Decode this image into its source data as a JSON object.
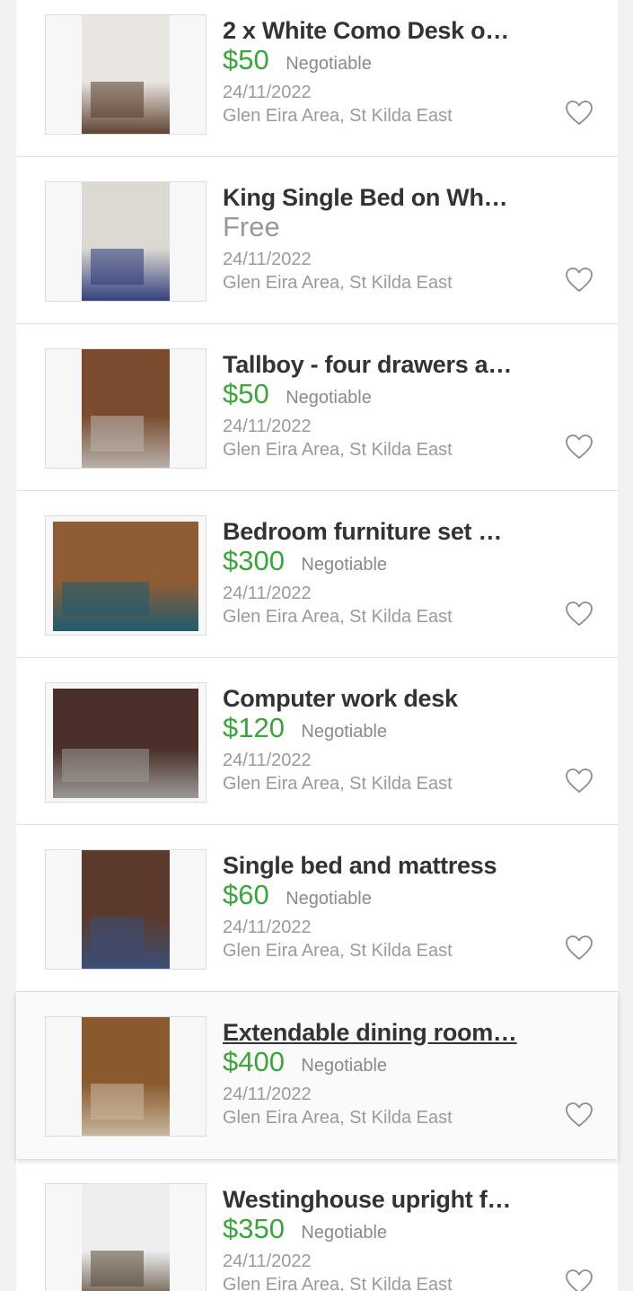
{
  "listings": [
    {
      "title": "2 x White Como Desk o…",
      "price": "$50",
      "negotiable": "Negotiable",
      "date": "24/11/2022",
      "location": "Glen Eira Area, St Kilda East",
      "photo_colors": [
        "#e9e6e1",
        "#5a3d2c"
      ]
    },
    {
      "title": "King Single Bed on Wh…",
      "price": "Free",
      "negotiable": "",
      "date": "24/11/2022",
      "location": "Glen Eira Area, St Kilda East",
      "photo_colors": [
        "#dcd8d2",
        "#2c3b7a"
      ]
    },
    {
      "title": "Tallboy - four drawers a…",
      "price": "$50",
      "negotiable": "Negotiable",
      "date": "24/11/2022",
      "location": "Glen Eira Area, St Kilda East",
      "photo_colors": [
        "#7a4b2c",
        "#b8b4ae"
      ]
    },
    {
      "title": "Bedroom furniture set …",
      "price": "$300",
      "negotiable": "Negotiable",
      "date": "24/11/2022",
      "location": "Glen Eira Area, St Kilda East",
      "photo_colors": [
        "#8f5d35",
        "#1e5c6e"
      ]
    },
    {
      "title": "Computer work desk",
      "price": "$120",
      "negotiable": "Negotiable",
      "date": "24/11/2022",
      "location": "Glen Eira Area, St Kilda East",
      "photo_colors": [
        "#4a2f2a",
        "#9c9a96"
      ]
    },
    {
      "title": "Single bed and mattress",
      "price": "$60",
      "negotiable": "Negotiable",
      "date": "24/11/2022",
      "location": "Glen Eira Area, St Kilda East",
      "photo_colors": [
        "#5b3a2c",
        "#3a4f7a"
      ]
    },
    {
      "title": "Extendable dining room…",
      "price": "$400",
      "negotiable": "Negotiable",
      "date": "24/11/2022",
      "location": "Glen Eira Area, St Kilda East",
      "photo_colors": [
        "#8a5a2e",
        "#c9b9a0"
      ]
    },
    {
      "title": "Westinghouse upright f…",
      "price": "$350",
      "negotiable": "Negotiable",
      "date": "24/11/2022",
      "location": "Glen Eira Area, St Kilda East",
      "photo_colors": [
        "#eeeeee",
        "#5a4a3a"
      ]
    }
  ],
  "favorite_icon": "heart-outline-icon",
  "hovered_index": 6
}
